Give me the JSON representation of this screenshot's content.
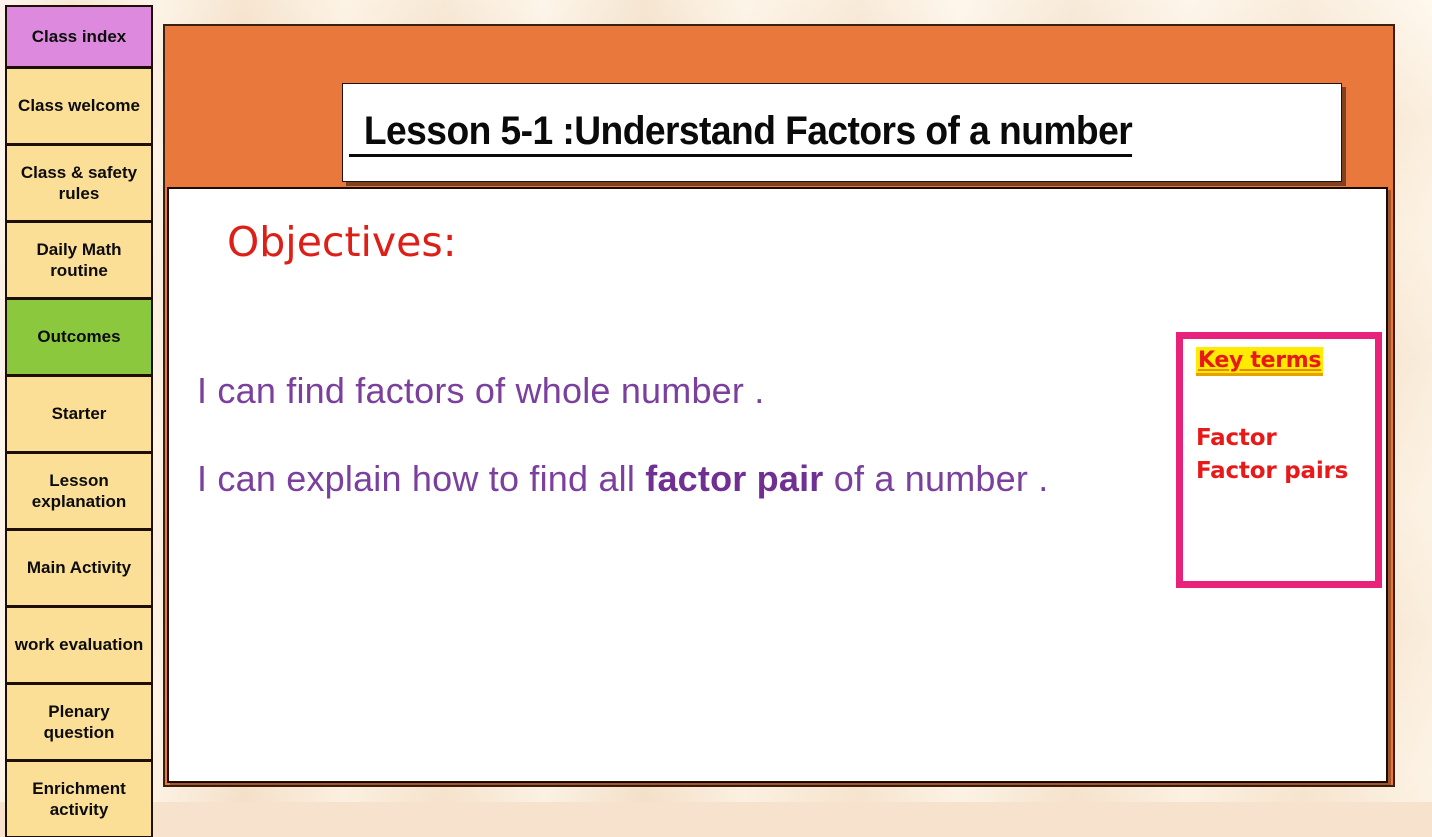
{
  "slide": {
    "title": "Lesson 5-1 :Understand Factors of a number",
    "objectives_heading": "Objectives:",
    "objectives": [
      {
        "pre": "I can find factors of whole number .",
        "bold": "",
        "post": ""
      },
      {
        "pre": "I can explain how to find all ",
        "bold": "factor pair",
        "post": " of a number ."
      }
    ],
    "key_terms": {
      "title": "Key terms",
      "terms": [
        "Factor",
        "Factor pairs"
      ]
    }
  },
  "sidebar": {
    "items": [
      {
        "label": "Class index",
        "style": "accent-purple"
      },
      {
        "label": "Class welcome",
        "style": ""
      },
      {
        "label": "Class & safety rules",
        "style": ""
      },
      {
        "label": "Daily Math routine",
        "style": ""
      },
      {
        "label": "Outcomes",
        "style": "accent-green"
      },
      {
        "label": "Starter",
        "style": ""
      },
      {
        "label": "Lesson explanation",
        "style": ""
      },
      {
        "label": "Main Activity",
        "style": ""
      },
      {
        "label": "work evaluation",
        "style": ""
      },
      {
        "label": "Plenary question",
        "style": ""
      },
      {
        "label": "Enrichment activity",
        "style": ""
      }
    ]
  },
  "colors": {
    "frame_orange": "#e8783c",
    "sidebar_yellow": "#fcdf96",
    "sidebar_purple": "#dd8ade",
    "sidebar_green": "#8bc83e",
    "objective_purple": "#7b3f9d",
    "heading_red": "#dd1f17",
    "key_terms_border": "#e8227a",
    "highlight_yellow": "#ffeb00"
  }
}
